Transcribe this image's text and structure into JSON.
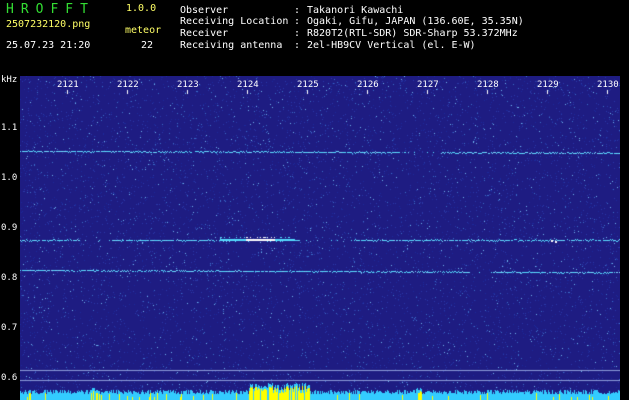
{
  "header": {
    "app_name": "HROFFT",
    "version": "1.0.0",
    "filename": "2507232120.png",
    "datetime": "25.07.23 21:20",
    "mode_label": "meteor",
    "count": "22"
  },
  "info": [
    {
      "label": "Observer",
      "value": "Takanori Kawachi"
    },
    {
      "label": "Receiving Location",
      "value": "Ogaki, Gifu, JAPAN (136.60E, 35.35N)"
    },
    {
      "label": "Receiver",
      "value": "R820T2(RTL-SDR) SDR-Sharp 53.372MHz"
    },
    {
      "label": "Receiving antenna",
      "value": "2el-HB9CV Vertical (el. E-W)"
    }
  ],
  "info_separator": ":",
  "colors": {
    "background": "#000000",
    "title_green": "#33dd33",
    "label_yellow": "#ffff66",
    "spectrogram_base": "#1e1c82",
    "echo_cyan": "#55ddff",
    "echo_white": "#ffffff",
    "noise_bar_cyan": "#33ccff",
    "noise_bar_yellow": "#ffff00"
  },
  "spectrogram": {
    "y_unit": "kHz",
    "y_ticks": [
      "1.1",
      "1.0",
      "0.9",
      "0.8",
      "0.7",
      "0.6"
    ],
    "x_ticks": [
      "2121",
      "2122",
      "2123",
      "2124",
      "2125",
      "2126",
      "2127",
      "2128",
      "2129",
      "2130"
    ]
  }
}
